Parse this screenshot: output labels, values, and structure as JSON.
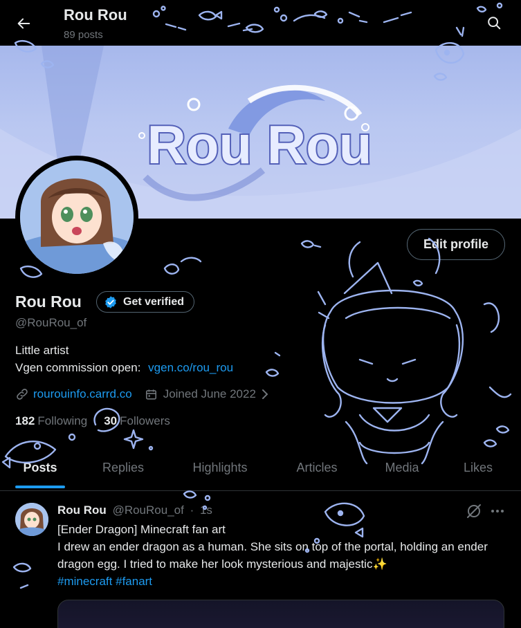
{
  "header": {
    "name": "Rou Rou",
    "post_count": "89 posts"
  },
  "banner": {
    "logo_text": "Rou Rou"
  },
  "profile": {
    "edit_button": "Edit profile",
    "display_name": "Rou Rou",
    "verified_label": "Get verified",
    "handle": "@RouRou_of",
    "bio_line1": "Little artist",
    "bio_line2_prefix": "Vgen commission open:",
    "bio_line2_link": "vgen.co/rou_rou",
    "website": "rourouinfo.carrd.co",
    "joined": "Joined June 2022",
    "following_count": "182",
    "following_label": "Following",
    "followers_count": "30",
    "followers_label": "Followers"
  },
  "tabs": [
    {
      "label": "Posts",
      "active": true
    },
    {
      "label": "Replies"
    },
    {
      "label": "Highlights"
    },
    {
      "label": "Articles"
    },
    {
      "label": "Media"
    },
    {
      "label": "Likes"
    }
  ],
  "post": {
    "name": "Rou Rou",
    "handle": "@RouRou_of",
    "dot": "·",
    "time": "1s",
    "line1": "[Ender Dragon] Minecraft fan art",
    "line2": "I drew an ender dragon as a human. She sits on top of the portal, holding an ender dragon egg. I tried to make her look mysterious and majestic✨",
    "hashtag1": "#minecraft",
    "hashtag2": "#fanart"
  },
  "colors": {
    "accent": "#1d9bf0",
    "muted": "#71767b",
    "doodle": "#9db4f0"
  }
}
